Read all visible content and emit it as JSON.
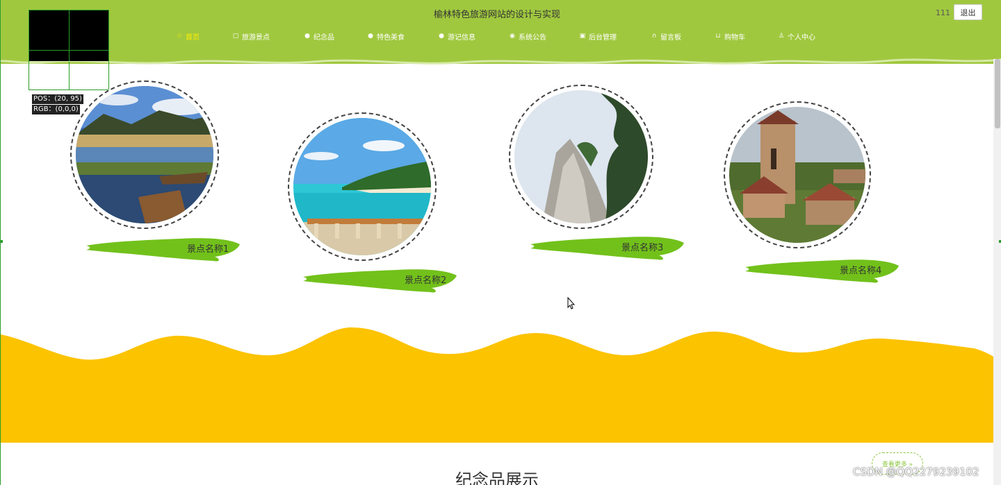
{
  "header": {
    "title": "榆林特色旅游网站的设计与实现",
    "user": "111",
    "logout": "退出"
  },
  "nav": [
    {
      "label": "首页",
      "icon": "star-icon",
      "active": true
    },
    {
      "label": "旅游景点",
      "icon": "bag-icon"
    },
    {
      "label": "纪念品",
      "icon": "info-icon"
    },
    {
      "label": "特色美食",
      "icon": "dot-icon"
    },
    {
      "label": "游记信息",
      "icon": "info-icon"
    },
    {
      "label": "系统公告",
      "icon": "globe-icon"
    },
    {
      "label": "后台管理",
      "icon": "clipboard-icon"
    },
    {
      "label": "留言板",
      "icon": "headset-icon"
    },
    {
      "label": "购物车",
      "icon": "cart-icon"
    },
    {
      "label": "个人中心",
      "icon": "user-icon"
    }
  ],
  "picker": {
    "pos": "POS：(20, 95)",
    "rgb": "RGB：(0,0,0)"
  },
  "spots": [
    {
      "label": "景点名称1",
      "image": "lake-boats"
    },
    {
      "label": "景点名称2",
      "image": "tropical-beach"
    },
    {
      "label": "景点名称3",
      "image": "cliff-mountain"
    },
    {
      "label": "景点名称4",
      "image": "stone-tower-village"
    }
  ],
  "souvenir": {
    "title": "纪念品展示",
    "more": "查看更多 »"
  },
  "watermark": "CSDN @QQ2279239102",
  "colors": {
    "header": "#a0c83f",
    "band": "#fcc300",
    "brush": "#72c11b",
    "nav_active": "#ffee00"
  }
}
